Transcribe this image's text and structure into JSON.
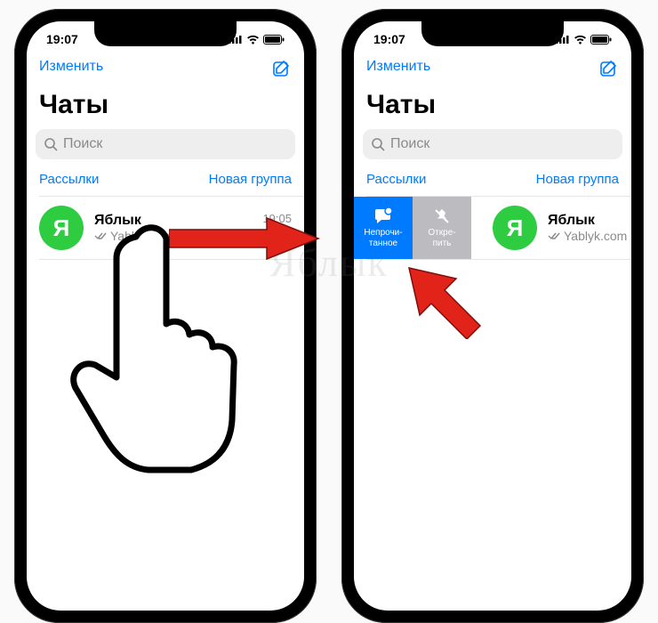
{
  "statusbar": {
    "time": "19:07"
  },
  "nav": {
    "edit": "Изменить"
  },
  "header": {
    "title": "Чаты"
  },
  "search": {
    "placeholder": "Поиск"
  },
  "links": {
    "broadcasts": "Рассылки",
    "newgroup": "Новая группа"
  },
  "chat": {
    "avatar_letter": "Я",
    "name": "Яблык",
    "subtitle": "Yablyk.com",
    "time": "19:05"
  },
  "swipe": {
    "unread": "Непрочи-\nтанное",
    "unpin": "Откре-\nпить"
  },
  "watermark": "Яблык"
}
